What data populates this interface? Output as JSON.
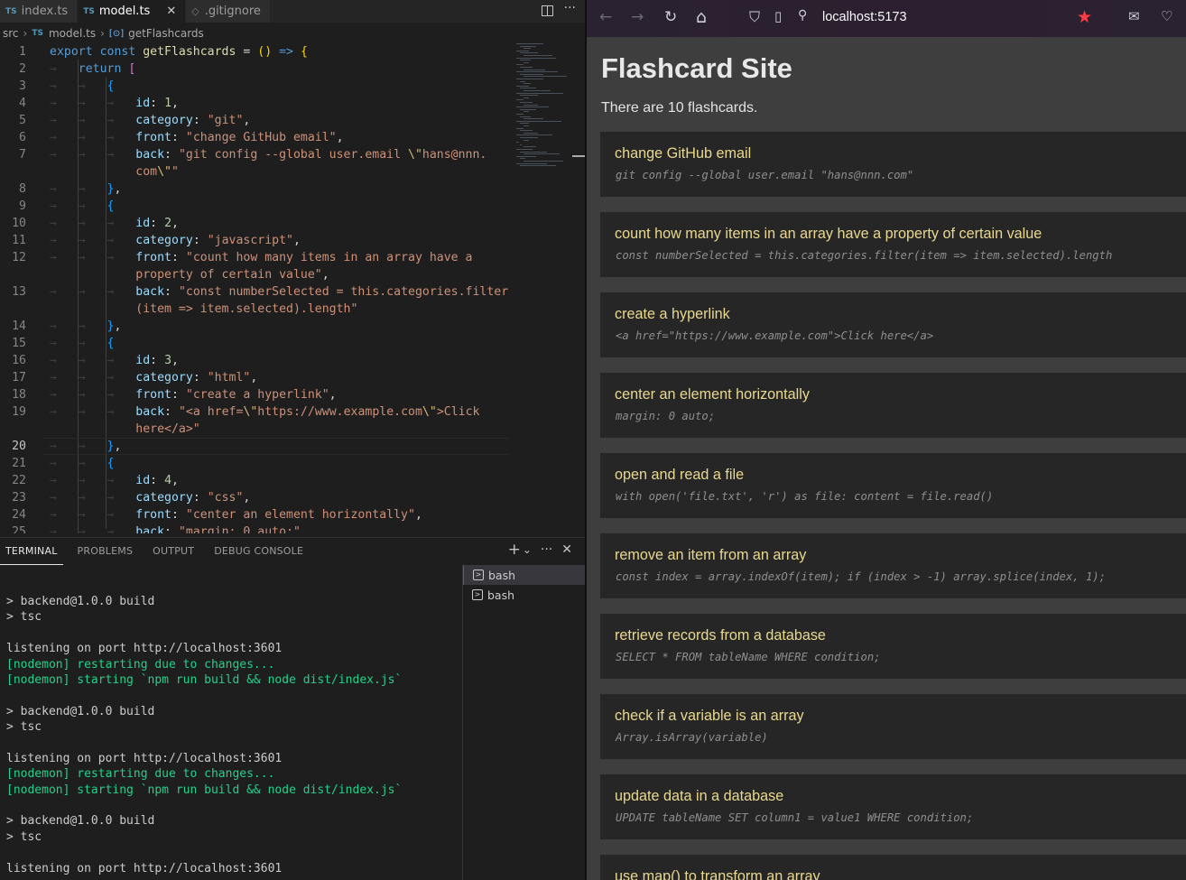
{
  "vscode": {
    "tabs": [
      {
        "badge": "TS",
        "label": "index.ts"
      },
      {
        "badge": "TS",
        "label": "model.ts"
      },
      {
        "badge": "◇",
        "label": ".gitignore"
      }
    ],
    "close_glyph": "✕",
    "tab_actions": {
      "more": "···"
    },
    "breadcrumb": {
      "folder": "src",
      "file_badge": "TS",
      "file": "model.ts",
      "symbol_icon": "[⊙]",
      "symbol": "getFlashcards"
    },
    "code_lines": [
      {
        "n": "1",
        "cls": "",
        "tokens": [
          [
            "kw",
            "export "
          ],
          [
            "kw",
            "const "
          ],
          [
            "fn",
            "getFlashcards"
          ],
          [
            "pn",
            " = "
          ],
          [
            "br2",
            "()"
          ],
          [
            "pn",
            " "
          ],
          [
            "kw",
            "=>"
          ],
          [
            "pn",
            " "
          ],
          [
            "br2",
            "{"
          ]
        ]
      },
      {
        "n": "2",
        "cls": "",
        "tokens": [
          [
            "ws",
            "→   "
          ],
          [
            "kw",
            "return "
          ],
          [
            "br",
            "["
          ]
        ]
      },
      {
        "n": "3",
        "cls": "",
        "tokens": [
          [
            "ws",
            "→   →   "
          ],
          [
            "br3",
            "{"
          ]
        ]
      },
      {
        "n": "4",
        "cls": "",
        "tokens": [
          [
            "ws",
            "→   →   →   "
          ],
          [
            "prop",
            "id"
          ],
          [
            "pn",
            ": "
          ],
          [
            "num",
            "1"
          ],
          [
            "pn",
            ","
          ]
        ]
      },
      {
        "n": "5",
        "cls": "",
        "tokens": [
          [
            "ws",
            "→   →   →   "
          ],
          [
            "prop",
            "category"
          ],
          [
            "pn",
            ": "
          ],
          [
            "str",
            "\"git\""
          ],
          [
            "pn",
            ","
          ]
        ]
      },
      {
        "n": "6",
        "cls": "",
        "tokens": [
          [
            "ws",
            "→   →   →   "
          ],
          [
            "prop",
            "front"
          ],
          [
            "pn",
            ": "
          ],
          [
            "str",
            "\"change GitHub email\""
          ],
          [
            "pn",
            ","
          ]
        ]
      },
      {
        "n": "7",
        "cls": "",
        "tokens": [
          [
            "ws",
            "→   →   →   "
          ],
          [
            "prop",
            "back"
          ],
          [
            "pn",
            ": "
          ],
          [
            "str",
            "\"git config --global user.email "
          ],
          [
            "esc",
            "\\\""
          ],
          [
            "str",
            "hans@nnn."
          ]
        ]
      },
      {
        "n": "",
        "cls": "",
        "tokens": [
          [
            "ws",
            "            "
          ],
          [
            "str",
            "com"
          ],
          [
            "esc",
            "\\\""
          ],
          [
            "str",
            "\""
          ]
        ]
      },
      {
        "n": "8",
        "cls": "",
        "tokens": [
          [
            "ws",
            "→   →   "
          ],
          [
            "br3",
            "}"
          ],
          [
            "pn",
            ","
          ]
        ]
      },
      {
        "n": "9",
        "cls": "",
        "tokens": [
          [
            "ws",
            "→   →   "
          ],
          [
            "br3",
            "{"
          ]
        ]
      },
      {
        "n": "10",
        "cls": "",
        "tokens": [
          [
            "ws",
            "→   →   →   "
          ],
          [
            "prop",
            "id"
          ],
          [
            "pn",
            ": "
          ],
          [
            "num",
            "2"
          ],
          [
            "pn",
            ","
          ]
        ]
      },
      {
        "n": "11",
        "cls": "",
        "tokens": [
          [
            "ws",
            "→   →   →   "
          ],
          [
            "prop",
            "category"
          ],
          [
            "pn",
            ": "
          ],
          [
            "str",
            "\"javascript\""
          ],
          [
            "pn",
            ","
          ]
        ]
      },
      {
        "n": "12",
        "cls": "",
        "tokens": [
          [
            "ws",
            "→   →   →   "
          ],
          [
            "prop",
            "front"
          ],
          [
            "pn",
            ": "
          ],
          [
            "str",
            "\"count how many items in an array have a"
          ]
        ]
      },
      {
        "n": "",
        "cls": "",
        "tokens": [
          [
            "ws",
            "            "
          ],
          [
            "str",
            "property of certain value\""
          ],
          [
            "pn",
            ","
          ]
        ]
      },
      {
        "n": "13",
        "cls": "",
        "tokens": [
          [
            "ws",
            "→   →   →   "
          ],
          [
            "prop",
            "back"
          ],
          [
            "pn",
            ": "
          ],
          [
            "str",
            "\"const numberSelected = this.categories.filter"
          ]
        ]
      },
      {
        "n": "",
        "cls": "",
        "tokens": [
          [
            "ws",
            "            "
          ],
          [
            "str",
            "(item => item.selected).length\""
          ]
        ]
      },
      {
        "n": "14",
        "cls": "",
        "tokens": [
          [
            "ws",
            "→   →   "
          ],
          [
            "br3",
            "}"
          ],
          [
            "pn",
            ","
          ]
        ]
      },
      {
        "n": "15",
        "cls": "",
        "tokens": [
          [
            "ws",
            "→   →   "
          ],
          [
            "br3",
            "{"
          ]
        ]
      },
      {
        "n": "16",
        "cls": "",
        "tokens": [
          [
            "ws",
            "→   →   →   "
          ],
          [
            "prop",
            "id"
          ],
          [
            "pn",
            ": "
          ],
          [
            "num",
            "3"
          ],
          [
            "pn",
            ","
          ]
        ]
      },
      {
        "n": "17",
        "cls": "",
        "tokens": [
          [
            "ws",
            "→   →   →   "
          ],
          [
            "prop",
            "category"
          ],
          [
            "pn",
            ": "
          ],
          [
            "str",
            "\"html\""
          ],
          [
            "pn",
            ","
          ]
        ]
      },
      {
        "n": "18",
        "cls": "",
        "tokens": [
          [
            "ws",
            "→   →   →   "
          ],
          [
            "prop",
            "front"
          ],
          [
            "pn",
            ": "
          ],
          [
            "str",
            "\"create a hyperlink\""
          ],
          [
            "pn",
            ","
          ]
        ]
      },
      {
        "n": "19",
        "cls": "",
        "tokens": [
          [
            "ws",
            "→   →   →   "
          ],
          [
            "prop",
            "back"
          ],
          [
            "pn",
            ": "
          ],
          [
            "str",
            "\"<a href="
          ],
          [
            "esc",
            "\\\""
          ],
          [
            "str",
            "https://www.example.com"
          ],
          [
            "esc",
            "\\\""
          ],
          [
            "str",
            ">Click "
          ]
        ]
      },
      {
        "n": "",
        "cls": "",
        "tokens": [
          [
            "ws",
            "            "
          ],
          [
            "str",
            "here</a>\""
          ]
        ]
      },
      {
        "n": "20",
        "cls": "cur",
        "tokens": [
          [
            "ws",
            "→   →   "
          ],
          [
            "br3",
            "}"
          ],
          [
            "pn",
            ","
          ]
        ]
      },
      {
        "n": "21",
        "cls": "",
        "tokens": [
          [
            "ws",
            "→   →   "
          ],
          [
            "br3",
            "{"
          ]
        ]
      },
      {
        "n": "22",
        "cls": "",
        "tokens": [
          [
            "ws",
            "→   →   →   "
          ],
          [
            "prop",
            "id"
          ],
          [
            "pn",
            ": "
          ],
          [
            "num",
            "4"
          ],
          [
            "pn",
            ","
          ]
        ]
      },
      {
        "n": "23",
        "cls": "",
        "tokens": [
          [
            "ws",
            "→   →   →   "
          ],
          [
            "prop",
            "category"
          ],
          [
            "pn",
            ": "
          ],
          [
            "str",
            "\"css\""
          ],
          [
            "pn",
            ","
          ]
        ]
      },
      {
        "n": "24",
        "cls": "",
        "tokens": [
          [
            "ws",
            "→   →   →   "
          ],
          [
            "prop",
            "front"
          ],
          [
            "pn",
            ": "
          ],
          [
            "str",
            "\"center an element horizontally\""
          ],
          [
            "pn",
            ","
          ]
        ]
      },
      {
        "n": "25",
        "cls": "",
        "tokens": [
          [
            "ws",
            "→   →   →   "
          ],
          [
            "prop",
            "back"
          ],
          [
            "pn",
            ": "
          ],
          [
            "str",
            "\"margin: 0 auto;\""
          ]
        ]
      }
    ],
    "panel": {
      "tabs": [
        "TERMINAL",
        "PROBLEMS",
        "OUTPUT",
        "DEBUG CONSOLE"
      ],
      "actions": {
        "add": "+",
        "dropdown": "⌄",
        "more": "···",
        "close": "✕"
      },
      "terminal_lines": [
        {
          "text": "> backend@1.0.0 build",
          "green": false
        },
        {
          "text": "> tsc",
          "green": false
        },
        {
          "text": "",
          "green": false
        },
        {
          "text": "listening on port http://localhost:3601",
          "green": false
        },
        {
          "text": "[nodemon] restarting due to changes...",
          "green": true
        },
        {
          "text": "[nodemon] starting `npm run build && node dist/index.js`",
          "green": true
        },
        {
          "text": "",
          "green": false
        },
        {
          "text": "> backend@1.0.0 build",
          "green": false
        },
        {
          "text": "> tsc",
          "green": false
        },
        {
          "text": "",
          "green": false
        },
        {
          "text": "listening on port http://localhost:3601",
          "green": false
        },
        {
          "text": "[nodemon] restarting due to changes...",
          "green": true
        },
        {
          "text": "[nodemon] starting `npm run build && node dist/index.js`",
          "green": true
        },
        {
          "text": "",
          "green": false
        },
        {
          "text": "> backend@1.0.0 build",
          "green": false
        },
        {
          "text": "> tsc",
          "green": false
        },
        {
          "text": "",
          "green": false
        },
        {
          "text": "listening on port http://localhost:3601",
          "green": false
        }
      ],
      "terminals": [
        {
          "icon": ">",
          "label": "bash"
        },
        {
          "icon": ">",
          "label": "bash"
        }
      ]
    }
  },
  "browser": {
    "url": "localhost:5173",
    "nav_icons": {
      "back": "←",
      "forward": "→",
      "reload": "↻",
      "home": "⌂",
      "shield": "⛉",
      "page": "▯",
      "perm": "⚲",
      "star": "★",
      "library": "✉",
      "pocket": "♡"
    },
    "accent_star_color": "#ff3b45",
    "page": {
      "title": "Flashcard Site",
      "count_text": "There are 10 flashcards.",
      "cards": [
        {
          "front": "change GitHub email",
          "back": "git config --global user.email \"hans@nnn.com\""
        },
        {
          "front": "count how many items in an array have a property of certain value",
          "back": "const numberSelected = this.categories.filter(item => item.selected).length"
        },
        {
          "front": "create a hyperlink",
          "back": "<a href=\"https://www.example.com\">Click here</a>"
        },
        {
          "front": "center an element horizontally",
          "back": "margin: 0 auto;"
        },
        {
          "front": "open and read a file",
          "back": "with open('file.txt', 'r') as file: content = file.read()"
        },
        {
          "front": "remove an item from an array",
          "back": "const index = array.indexOf(item); if (index > -1) array.splice(index, 1);"
        },
        {
          "front": "retrieve records from a database",
          "back": "SELECT * FROM tableName WHERE condition;"
        },
        {
          "front": "check if a variable is an array",
          "back": "Array.isArray(variable)"
        },
        {
          "front": "update data in a database",
          "back": "UPDATE tableName SET column1 = value1 WHERE condition;"
        },
        {
          "front": "use map() to transform an array",
          "back": ""
        }
      ]
    }
  }
}
